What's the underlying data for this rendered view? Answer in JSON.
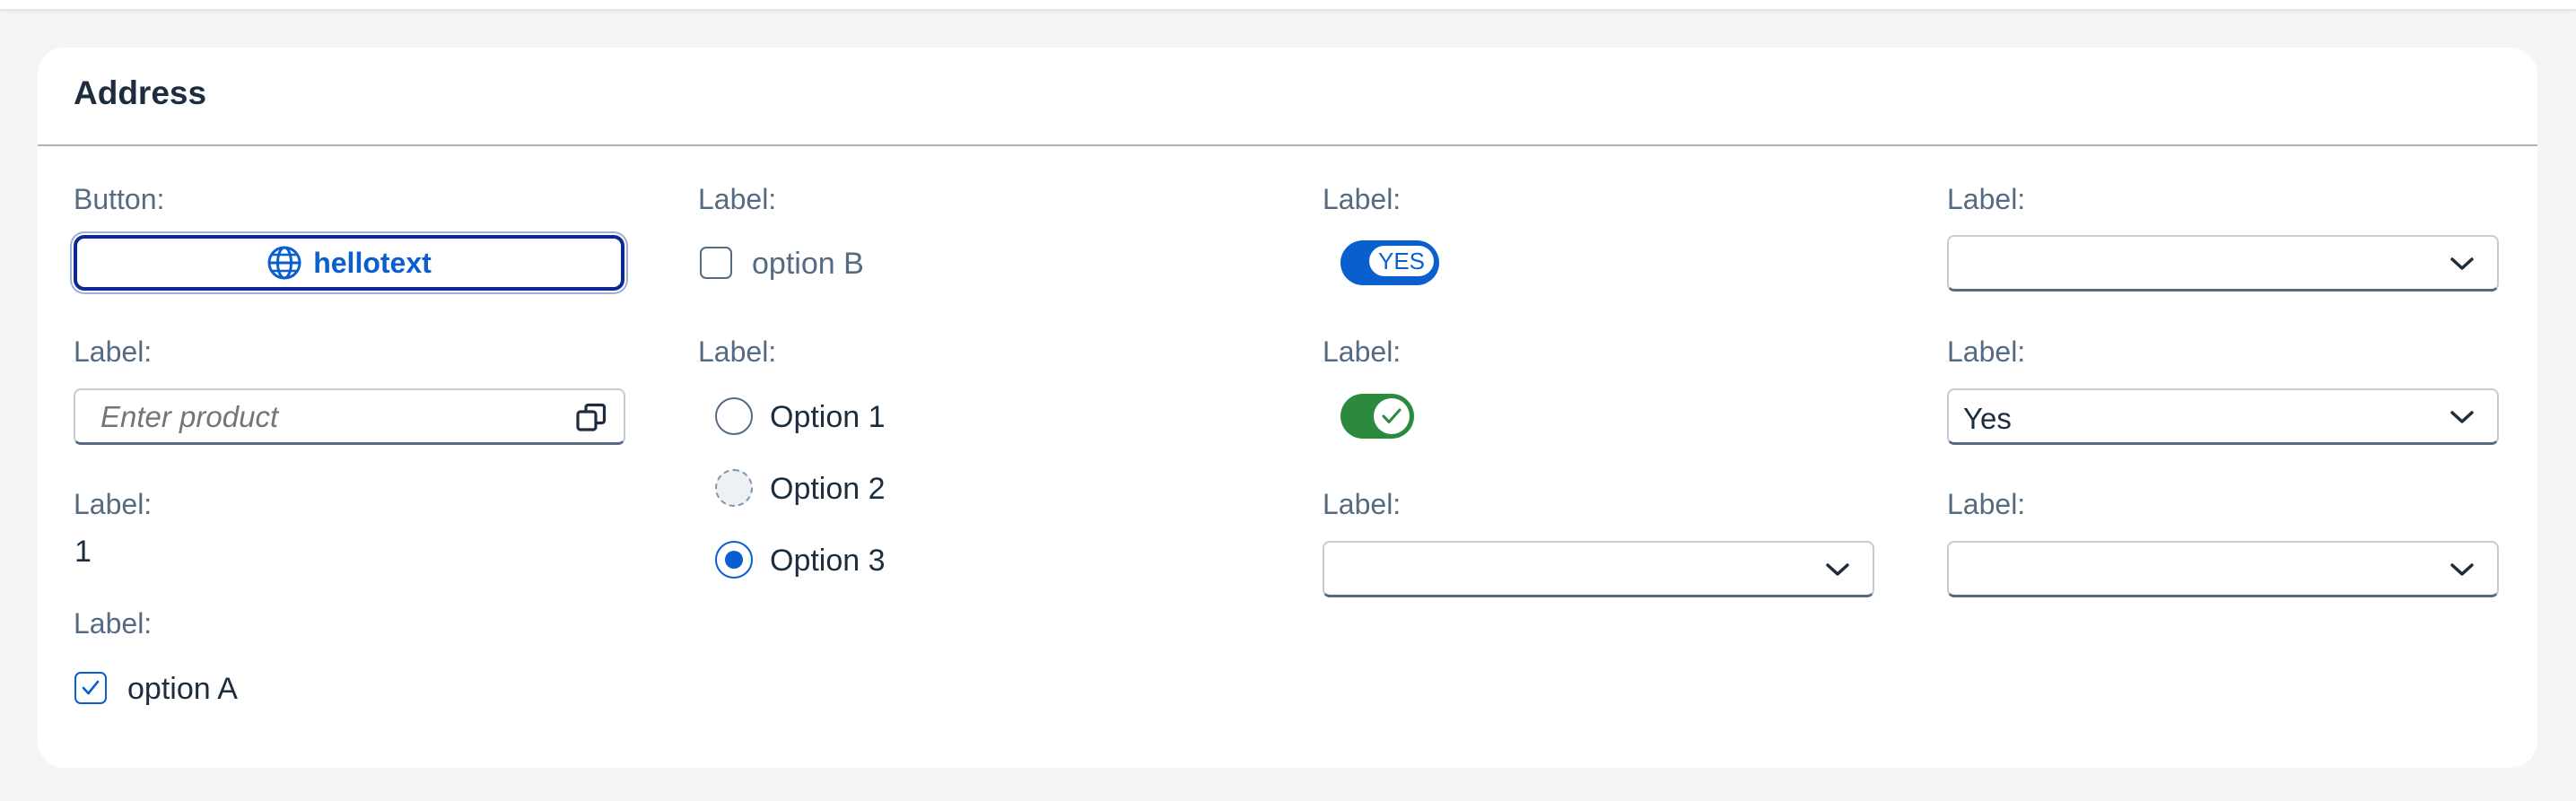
{
  "section": {
    "title": "Address"
  },
  "columns": {
    "col1": {
      "button_label_text": "Button:",
      "button_text": "hellotext",
      "input_label": "Label:",
      "input_placeholder": "Enter product",
      "value_label": "Label:",
      "value_text": "1",
      "checkbox_label": "Label:",
      "checkbox_text": "option A",
      "checkbox_checked": true
    },
    "col2": {
      "checkbox_label": "Label:",
      "checkbox_text": "option B",
      "checkbox_checked": false,
      "radio_label": "Label:",
      "radio_options": [
        "Option 1",
        "Option 2",
        "Option 3"
      ],
      "radio_selected": "Option 3"
    },
    "col3": {
      "switch1_label": "Label:",
      "switch1_text": "YES",
      "switch2_label": "Label:",
      "select_label": "Label:",
      "select_value": ""
    },
    "col4": {
      "select1_label": "Label:",
      "select1_value": "",
      "select2_label": "Label:",
      "select2_value": "Yes",
      "select3_label": "Label:",
      "select3_value": ""
    }
  },
  "colors": {
    "accent": "#0a5fcf",
    "success": "#2b8a3e",
    "label": "#556b82",
    "text": "#1d2d3e"
  },
  "icons": [
    "globe-icon",
    "value-help-icon",
    "checkmark-icon",
    "chevron-down-icon"
  ]
}
